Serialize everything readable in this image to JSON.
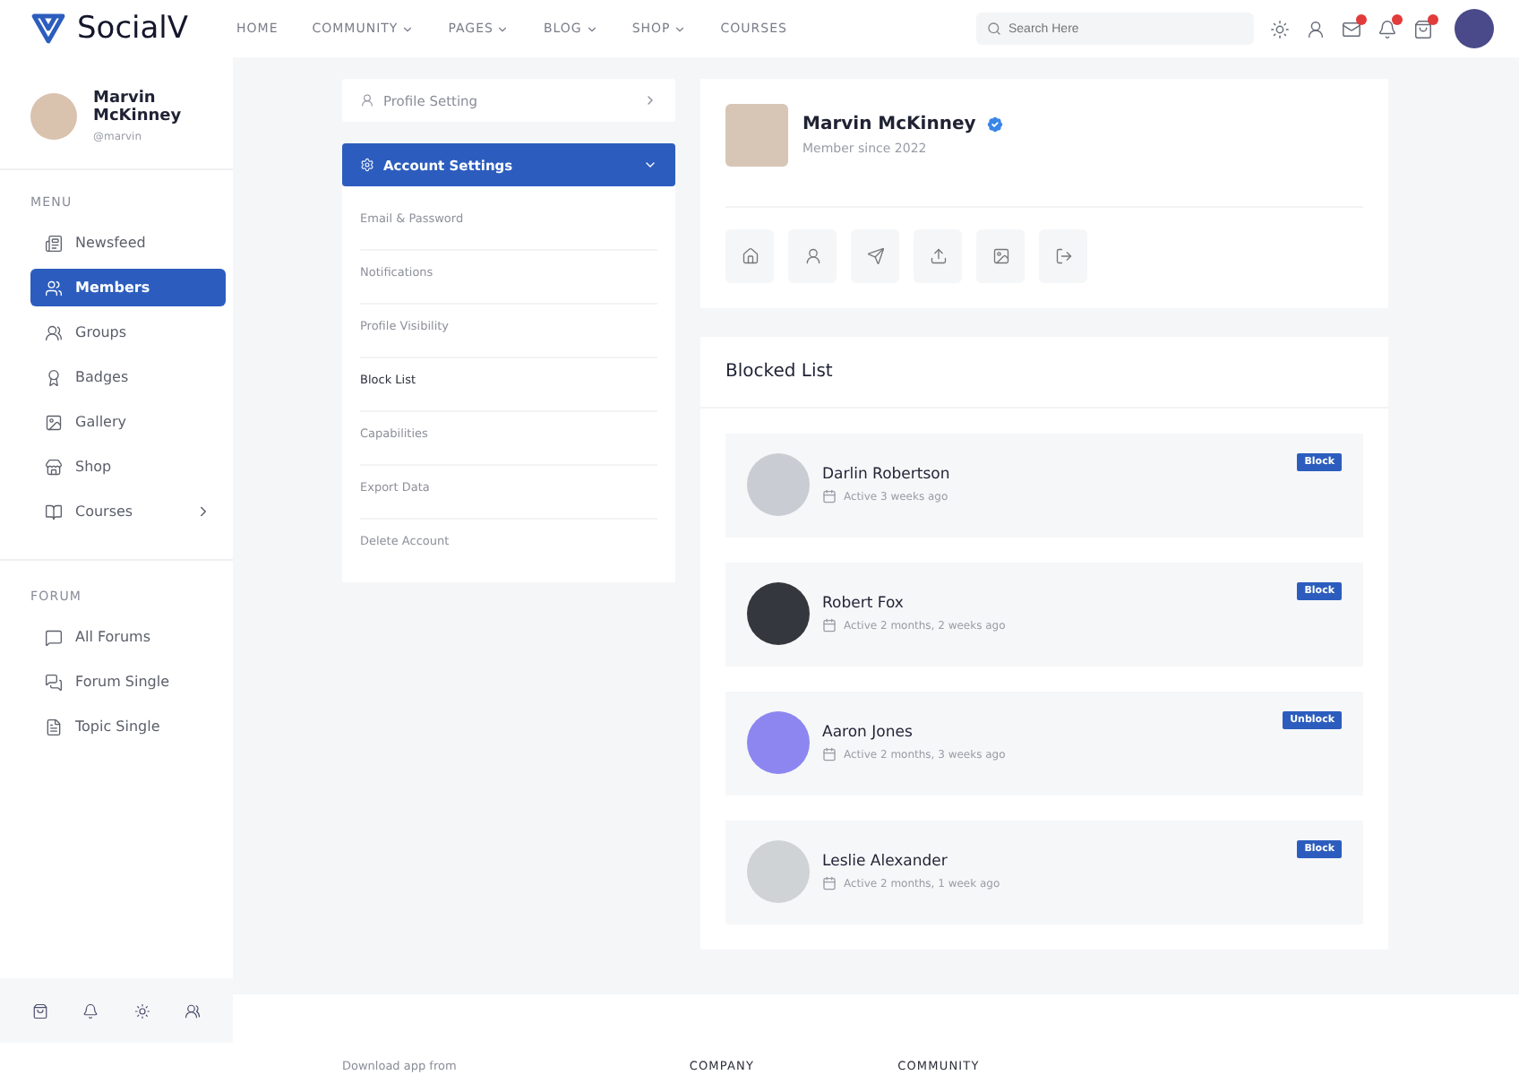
{
  "brand": {
    "name": "SocialV"
  },
  "nav": [
    {
      "label": "HOME",
      "dropdown": false
    },
    {
      "label": "COMMUNITY",
      "dropdown": true
    },
    {
      "label": "PAGES",
      "dropdown": true
    },
    {
      "label": "BLOG",
      "dropdown": true
    },
    {
      "label": "SHOP",
      "dropdown": true
    },
    {
      "label": "COURSES",
      "dropdown": false
    }
  ],
  "search": {
    "placeholder": "Search Here"
  },
  "header_icons": [
    {
      "kind": "sun",
      "badge": false
    },
    {
      "kind": "user",
      "badge": false
    },
    {
      "kind": "mail",
      "badge": true
    },
    {
      "kind": "bell",
      "badge": true
    },
    {
      "kind": "bag",
      "badge": true
    }
  ],
  "sidebar": {
    "user": {
      "name": "Marvin McKinney",
      "handle": "@marvin"
    },
    "sections": [
      {
        "title": "MENU",
        "items": [
          {
            "label": "Newsfeed",
            "selected": false,
            "expandable": false
          },
          {
            "label": "Members",
            "selected": true,
            "expandable": false
          },
          {
            "label": "Groups",
            "selected": false,
            "expandable": false
          },
          {
            "label": "Badges",
            "selected": false,
            "expandable": false
          },
          {
            "label": "Gallery",
            "selected": false,
            "expandable": false
          },
          {
            "label": "Shop",
            "selected": false,
            "expandable": false
          },
          {
            "label": "Courses",
            "selected": false,
            "expandable": true
          }
        ]
      },
      {
        "title": "FORUM",
        "items": [
          {
            "label": "All Forums",
            "selected": false,
            "expandable": false
          },
          {
            "label": "Forum Single",
            "selected": false,
            "expandable": false
          },
          {
            "label": "Topic Single",
            "selected": false,
            "expandable": false
          }
        ]
      }
    ]
  },
  "settings": [
    {
      "label": "Profile Setting",
      "expanded": false
    },
    {
      "label": "Account Settings",
      "expanded": true,
      "children": [
        {
          "label": "Email & Password",
          "selected": false
        },
        {
          "label": "Notifications",
          "selected": false
        },
        {
          "label": "Profile Visibility",
          "selected": false
        },
        {
          "label": "Block List",
          "selected": true
        },
        {
          "label": "Capabilities",
          "selected": false
        },
        {
          "label": "Export Data",
          "selected": false
        },
        {
          "label": "Delete Account",
          "selected": false
        }
      ]
    }
  ],
  "profile": {
    "name": "Marvin McKinney",
    "verified": true,
    "since": "Member since 2022"
  },
  "blocked": {
    "title": "Blocked List",
    "users": [
      {
        "name": "Darlin Robertson",
        "active": "Active 3 weeks ago",
        "button": "Block",
        "color": "#c9cdd3"
      },
      {
        "name": "Robert Fox",
        "active": "Active 2 months, 2 weeks ago",
        "button": "Block",
        "color": "#34373d"
      },
      {
        "name": "Aaron Jones",
        "active": "Active 2 months, 3 weeks ago",
        "button": "Unblock",
        "color": "#8d86f0"
      },
      {
        "name": "Leslie Alexander",
        "active": "Active 2 months, 1 week ago",
        "button": "Block",
        "color": "#cfd3d6"
      }
    ]
  },
  "footer": {
    "download": "Download app from",
    "columns": [
      "COMPANY",
      "COMMUNITY"
    ]
  }
}
